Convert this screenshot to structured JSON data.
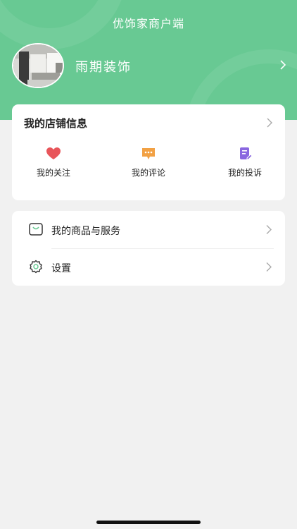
{
  "header": {
    "app_title": "优饰家商户端",
    "store_name": "雨期装饰",
    "bg_color": "#68c993"
  },
  "shop_info": {
    "title": "我的店铺信息",
    "actions": [
      {
        "label": "我的关注",
        "icon": "heart-icon",
        "color": "#e8555a"
      },
      {
        "label": "我的评论",
        "icon": "comment-icon",
        "color": "#f2a144"
      },
      {
        "label": "我的投诉",
        "icon": "edit-document-icon",
        "color": "#8a67e0"
      }
    ]
  },
  "menu": {
    "items": [
      {
        "label": "我的商品与服务",
        "icon": "shopping-bag-icon"
      },
      {
        "label": "设置",
        "icon": "settings-gear-icon"
      }
    ]
  }
}
